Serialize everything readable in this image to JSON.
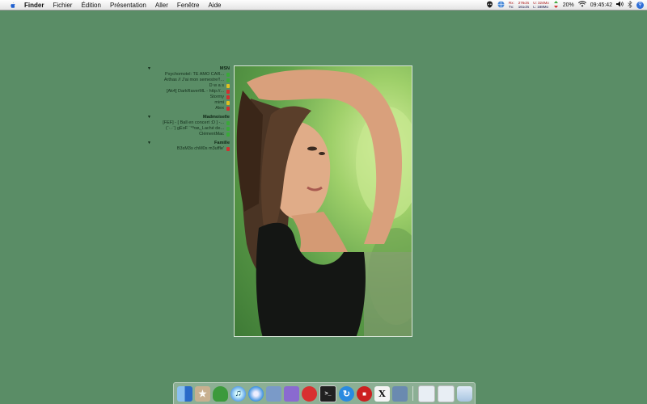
{
  "menubar": {
    "apple_icon": "apple-logo-icon",
    "items": [
      "Finder",
      "Fichier",
      "Édition",
      "Présentation",
      "Aller",
      "Fenêtre",
      "Aide"
    ],
    "network": {
      "rx_label": "Rx:",
      "tx_label": "Tx:",
      "rx_rate": "276o/s",
      "tx_rate": "161o/s",
      "upload": "U: 324Mo",
      "download": "L: 188Mo"
    },
    "battery": "20%",
    "clock": "09:45:42"
  },
  "buddylist": {
    "groups": [
      {
        "name": "MSN",
        "buddies": [
          {
            "name": "Psychomotel: TE AMO CAR...",
            "status": "#3aa83a"
          },
          {
            "name": "Arthas // J'ai mon semestre!!...",
            "status": "#3aa83a"
          },
          {
            "name": "D w a s",
            "status": "#e0c020"
          },
          {
            "name": "[Ak4] DarkRaverML - http://...",
            "status": "#d03030"
          },
          {
            "name": "Stormy",
            "status": "#d03030"
          },
          {
            "name": "mimi",
            "status": "#e0c020"
          },
          {
            "name": "Alex",
            "status": "#d03030"
          }
        ]
      },
      {
        "name": "Madmoiselle",
        "buddies": [
          {
            "name": "[FEF] - [ Ball en concert :D ] -...",
            "status": "#3aa83a"
          },
          {
            "name": "(¨·.·¨) gEoF ¨°º¤ø„¸Laché de...",
            "status": "#3aa83a"
          },
          {
            "name": "ClémentMac",
            "status": "#3aa83a"
          }
        ]
      },
      {
        "name": "Famille",
        "buddies": [
          {
            "name": "B3sM3s chM0s m3uffle'",
            "status": "#d03030"
          }
        ]
      }
    ]
  },
  "dock": {
    "apps": [
      {
        "icon": "finder-icon",
        "color": "#4a86d8"
      },
      {
        "icon": "cyberduck-icon",
        "color": "#c8b090"
      },
      {
        "icon": "adium-duck-icon",
        "color": "#3c9a3c"
      },
      {
        "icon": "itunes-icon",
        "color": "#5aa0e8"
      },
      {
        "icon": "safari-icon",
        "color": "#3a8fe0"
      },
      {
        "icon": "preview-icon",
        "color": "#7a9ac8"
      },
      {
        "icon": "transmission-icon",
        "color": "#8a6ad0"
      },
      {
        "icon": "tomato-icon",
        "color": "#d83030"
      },
      {
        "icon": "terminal-icon",
        "color": "#202020"
      },
      {
        "icon": "sync-icon",
        "color": "#2a8ae0"
      },
      {
        "icon": "stop-icon",
        "color": "#cc2020"
      },
      {
        "icon": "x11-icon",
        "color": "#f4f4f4"
      },
      {
        "icon": "iphoto-icon",
        "color": "#6a8ab0"
      }
    ],
    "right_items": [
      {
        "icon": "downloads-folder-icon",
        "color": "#e8eef4"
      },
      {
        "icon": "documents-folder-icon",
        "color": "#e8eef4"
      },
      {
        "icon": "trash-icon",
        "color": "#c0d4e8"
      }
    ]
  }
}
